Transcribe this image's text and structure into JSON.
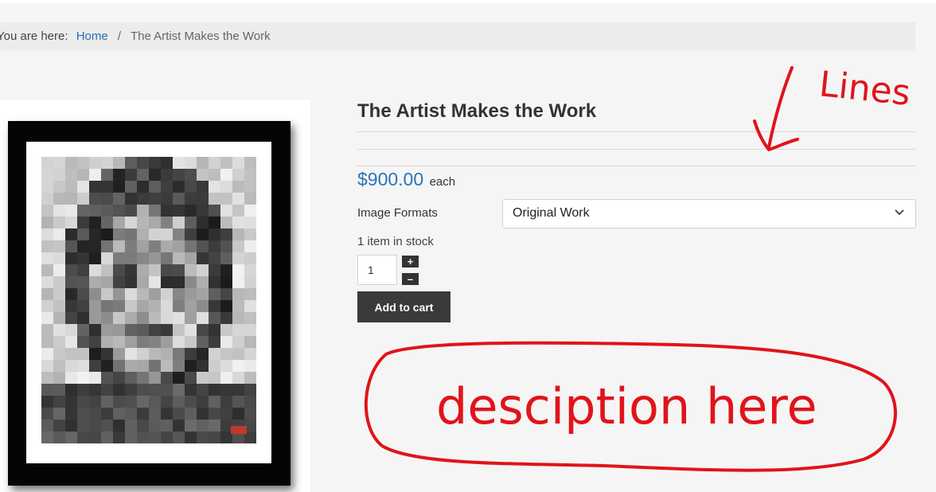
{
  "breadcrumb": {
    "lead": "You are here:",
    "home": "Home",
    "separator": "/",
    "current": "The Artist Makes the Work"
  },
  "product": {
    "title": "The Artist Makes the Work",
    "price": "$900.00",
    "price_unit": "each",
    "format_label": "Image Formats",
    "format_selected": "Original Work",
    "stock": "1 item in stock",
    "quantity": "1",
    "increment_label": "+",
    "decrement_label": "–",
    "add_to_cart": "Add to cart"
  },
  "annotations": {
    "lines_note": "Lines",
    "description_note": "desciption here"
  },
  "colors": {
    "price": "#2a73b8",
    "link": "#2a6fb0",
    "button": "#3a3a3a",
    "annotation": "#e0141a"
  },
  "icons": {
    "select": "chevron-down-icon",
    "annotation_arrow": "arrow-down-icon"
  }
}
